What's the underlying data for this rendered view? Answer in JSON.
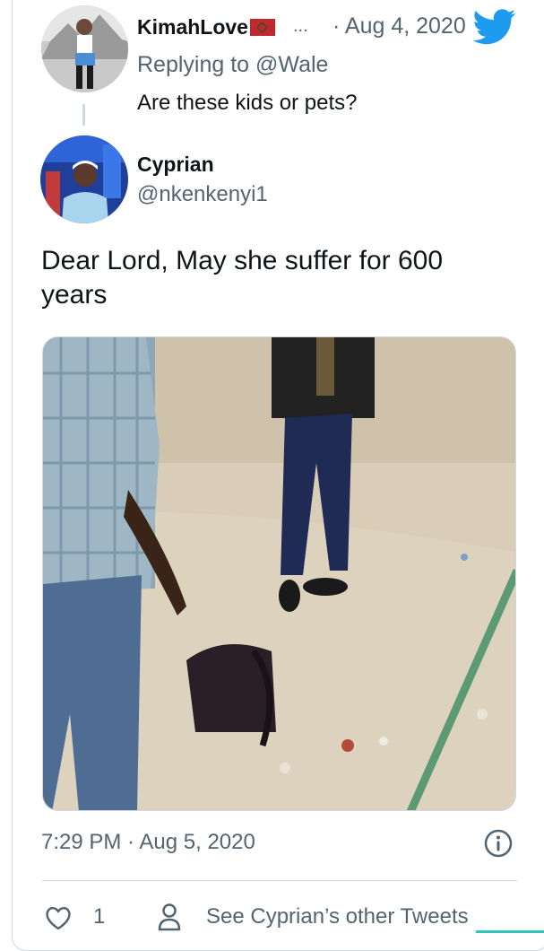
{
  "reply_tweet": {
    "display_name": "KimahLove",
    "name_flag_icon": "morocco-flag-icon",
    "ellipsis": "...",
    "date": "· Aug 4, 2020",
    "replying_to": "Replying to @Wale",
    "text": "Are these kids or pets?"
  },
  "main_tweet": {
    "display_name": "Cyprian",
    "handle": "@nkenkenyi1",
    "text": "Dear Lord, May she suffer for 600 years",
    "media_icon": "photo-icon",
    "timestamp": "7:29 PM · Aug 5, 2020"
  },
  "actions": {
    "like_count": "1",
    "other_tweets_label": "See Cyprian’s other Tweets"
  },
  "colors": {
    "brand_blue": "#1d9bf0",
    "text_primary": "#0f1419",
    "text_secondary": "#536471",
    "border": "#cfd9de"
  }
}
